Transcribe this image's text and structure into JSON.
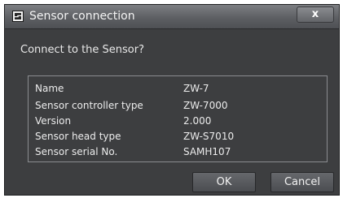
{
  "window": {
    "title": "Sensor connection",
    "close_label": "x"
  },
  "dialog": {
    "prompt": "Connect to the Sensor?",
    "rows": [
      {
        "label": "Name",
        "value": "ZW-7"
      },
      {
        "label": "Sensor controller type",
        "value": "ZW-7000"
      },
      {
        "label": "Version",
        "value": "2.000"
      },
      {
        "label": "Sensor head type",
        "value": "ZW-S7010"
      },
      {
        "label": "Sensor serial No.",
        "value": "SAMH107"
      }
    ]
  },
  "buttons": {
    "ok_label": "OK",
    "cancel_label": "Cancel"
  },
  "icons": {
    "app": "sensor-app-icon",
    "close": "close-icon"
  },
  "colors": {
    "dialog_bg": "#3d3e40",
    "titlebar": "#5d5f63",
    "text": "#ececec",
    "border": "#8a8c90"
  }
}
